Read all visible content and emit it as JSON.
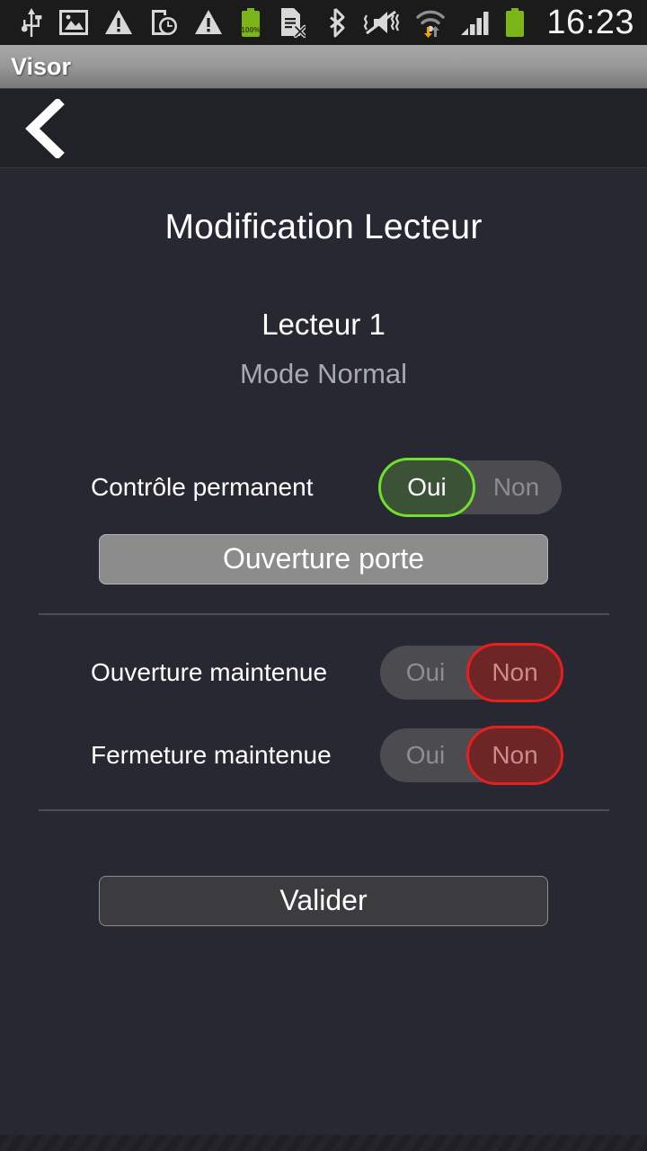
{
  "status_bar": {
    "clock": "16:23",
    "battery_label": "100%",
    "icons_left": [
      "usb-icon",
      "image-icon",
      "warning-triangle-icon",
      "device-clock-icon",
      "warning-triangle-2-icon",
      "battery-full-icon",
      "sim-card-error-icon"
    ],
    "icons_right": [
      "bluetooth-icon",
      "vibrate-mute-icon",
      "wifi-transfer-icon",
      "cellular-signal-icon",
      "battery-status-icon"
    ]
  },
  "app": {
    "title": "Visor",
    "back_label": "<"
  },
  "page": {
    "title": "Modification Lecteur",
    "device_name": "Lecteur 1",
    "device_mode": "Mode Normal"
  },
  "settings": [
    {
      "label": "Contrôle permanent",
      "option_yes": "Oui",
      "option_no": "Non",
      "selected": "Oui"
    },
    {
      "label": "Ouverture maintenue",
      "option_yes": "Oui",
      "option_no": "Non",
      "selected": "Non"
    },
    {
      "label": "Fermeture maintenue",
      "option_yes": "Oui",
      "option_no": "Non",
      "selected": "Non"
    }
  ],
  "buttons": {
    "door_open": "Ouverture porte",
    "validate": "Valider"
  },
  "colors": {
    "background": "#282832",
    "nav_background": "#212128",
    "title_bar_top": "#a8a8a8",
    "title_bar_bottom": "#787878",
    "accent_green": "#6fe02c",
    "accent_green_fill": "#3c5236",
    "accent_red": "#e61f1f",
    "accent_red_fill": "#6e2526",
    "toggle_track": "#4b4b50",
    "divider": "#4e4e57",
    "door_button": "#8c8c8c",
    "validate_button": "#3c3c3e"
  }
}
